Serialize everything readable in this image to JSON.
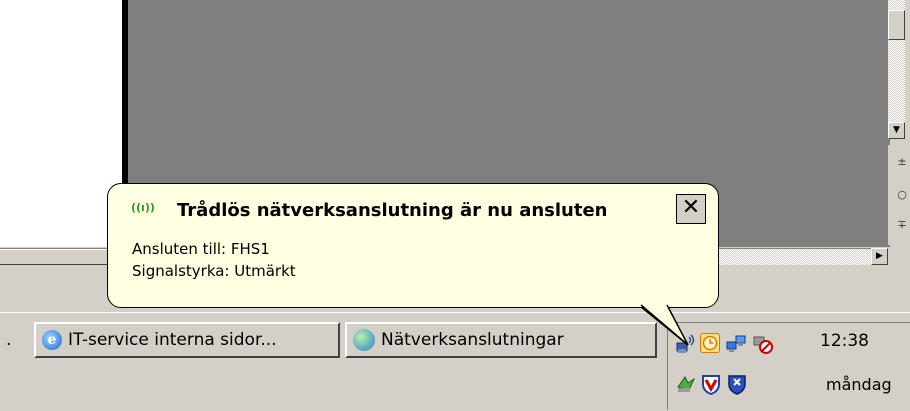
{
  "balloon": {
    "title": "Trådlös nätverksanslutning är nu ansluten",
    "line1": "Ansluten till:  FHS1",
    "line2": "Signalstyrka: Utmärkt",
    "close_label": "✕"
  },
  "taskbar": {
    "overflow_label": ".",
    "buttons": [
      {
        "label": "IT-service interna sidor...",
        "icon": "internet-explorer-icon"
      },
      {
        "label": "Nätverksanslutningar",
        "icon": "network-connections-icon"
      }
    ]
  },
  "tray": {
    "time": "12:38",
    "day": "måndag",
    "icons": [
      "wireless-network-icon",
      "clock-icon",
      "network-icon",
      "disconnected-icon",
      "mcafee-agent-icon",
      "mcafee-shield-icon",
      "security-icon"
    ]
  },
  "colors": {
    "balloon_bg": "#ffffe1",
    "desktop_gray": "#7f7f7f",
    "taskbar_bg": "#d4d0c8"
  }
}
